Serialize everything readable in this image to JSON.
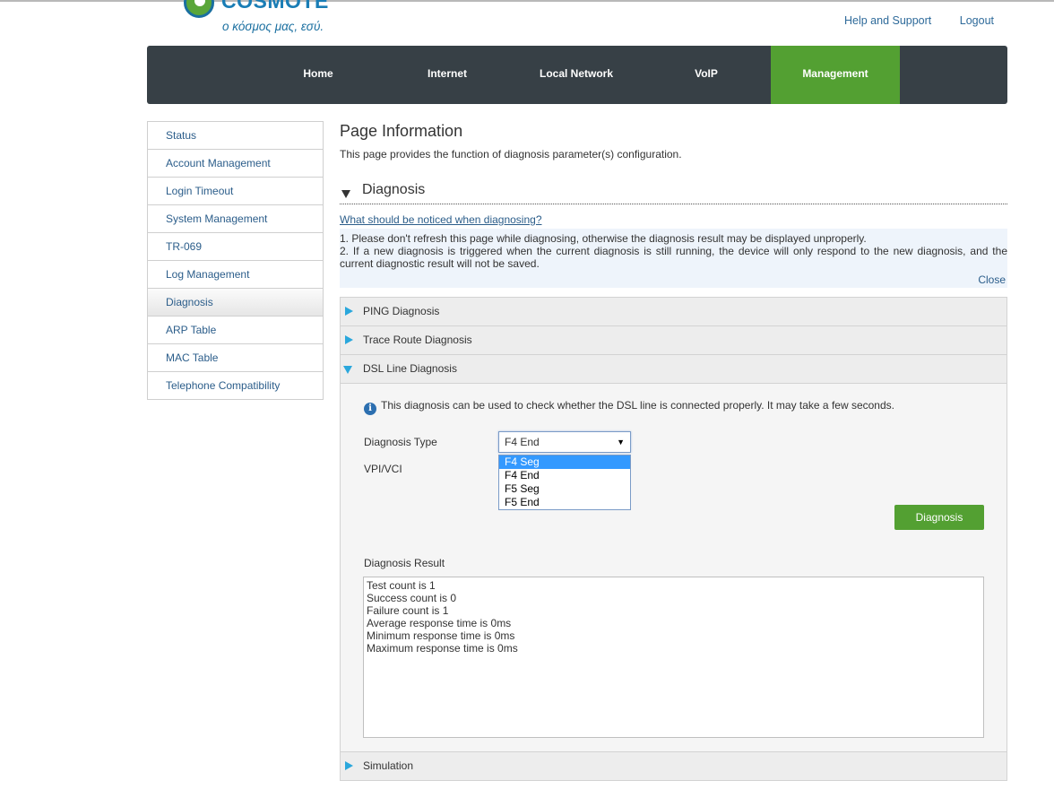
{
  "brand": {
    "name": "COSMOTE",
    "tagline": "ο κόσμος μας, εσύ."
  },
  "top_links": {
    "help": "Help and Support",
    "logout": "Logout"
  },
  "nav": {
    "items": [
      "Home",
      "Internet",
      "Local Network",
      "VoIP",
      "Management"
    ],
    "active": "Management"
  },
  "sidebar": {
    "items": [
      {
        "label": "Status"
      },
      {
        "label": "Account Management"
      },
      {
        "label": "Login Timeout"
      },
      {
        "label": "System Management"
      },
      {
        "label": "TR-069"
      },
      {
        "label": "Log Management"
      },
      {
        "label": "Diagnosis"
      },
      {
        "label": "ARP Table"
      },
      {
        "label": "MAC Table"
      },
      {
        "label": "Telephone Compatibility"
      }
    ],
    "active": "Diagnosis"
  },
  "page": {
    "title": "Page Information",
    "description": "This page provides the function of diagnosis parameter(s) configuration."
  },
  "section": {
    "title": "Diagnosis",
    "notice_link": "What should be noticed when diagnosing?",
    "notice_lines": [
      "1. Please don't refresh this page while diagnosing, otherwise the diagnosis result may be displayed unproperly.",
      "2. If a new diagnosis is triggered when the current diagnosis is still running, the device will only respond to the new diagnosis, and the current diagnostic result will not be saved."
    ],
    "close_label": "Close"
  },
  "accordion": {
    "ping": "PING Diagnosis",
    "trace": "Trace Route Diagnosis",
    "dsl": "DSL Line Diagnosis",
    "simulation": "Simulation"
  },
  "dsl": {
    "info": "This diagnosis can be used to check whether the DSL line is connected properly. It may take a few seconds.",
    "type_label": "Diagnosis Type",
    "type_value": "F4 End",
    "options": [
      "F4 Seg",
      "F4 End",
      "F5 Seg",
      "F5 End"
    ],
    "highlighted_option": "F4 Seg",
    "vpi_label": "VPI/VCI",
    "button": "Diagnosis",
    "result_label": "Diagnosis Result",
    "result_lines": [
      "Test count is 1",
      "Success count is 0",
      "Failure count is 1",
      "Average response time is 0ms",
      "Minimum response time is 0ms",
      "Maximum response time is 0ms"
    ]
  },
  "colors": {
    "nav_bg": "#374046",
    "accent_green": "#53a032",
    "link_blue": "#2b5d8a",
    "triangle_blue": "#2aa7dc"
  }
}
